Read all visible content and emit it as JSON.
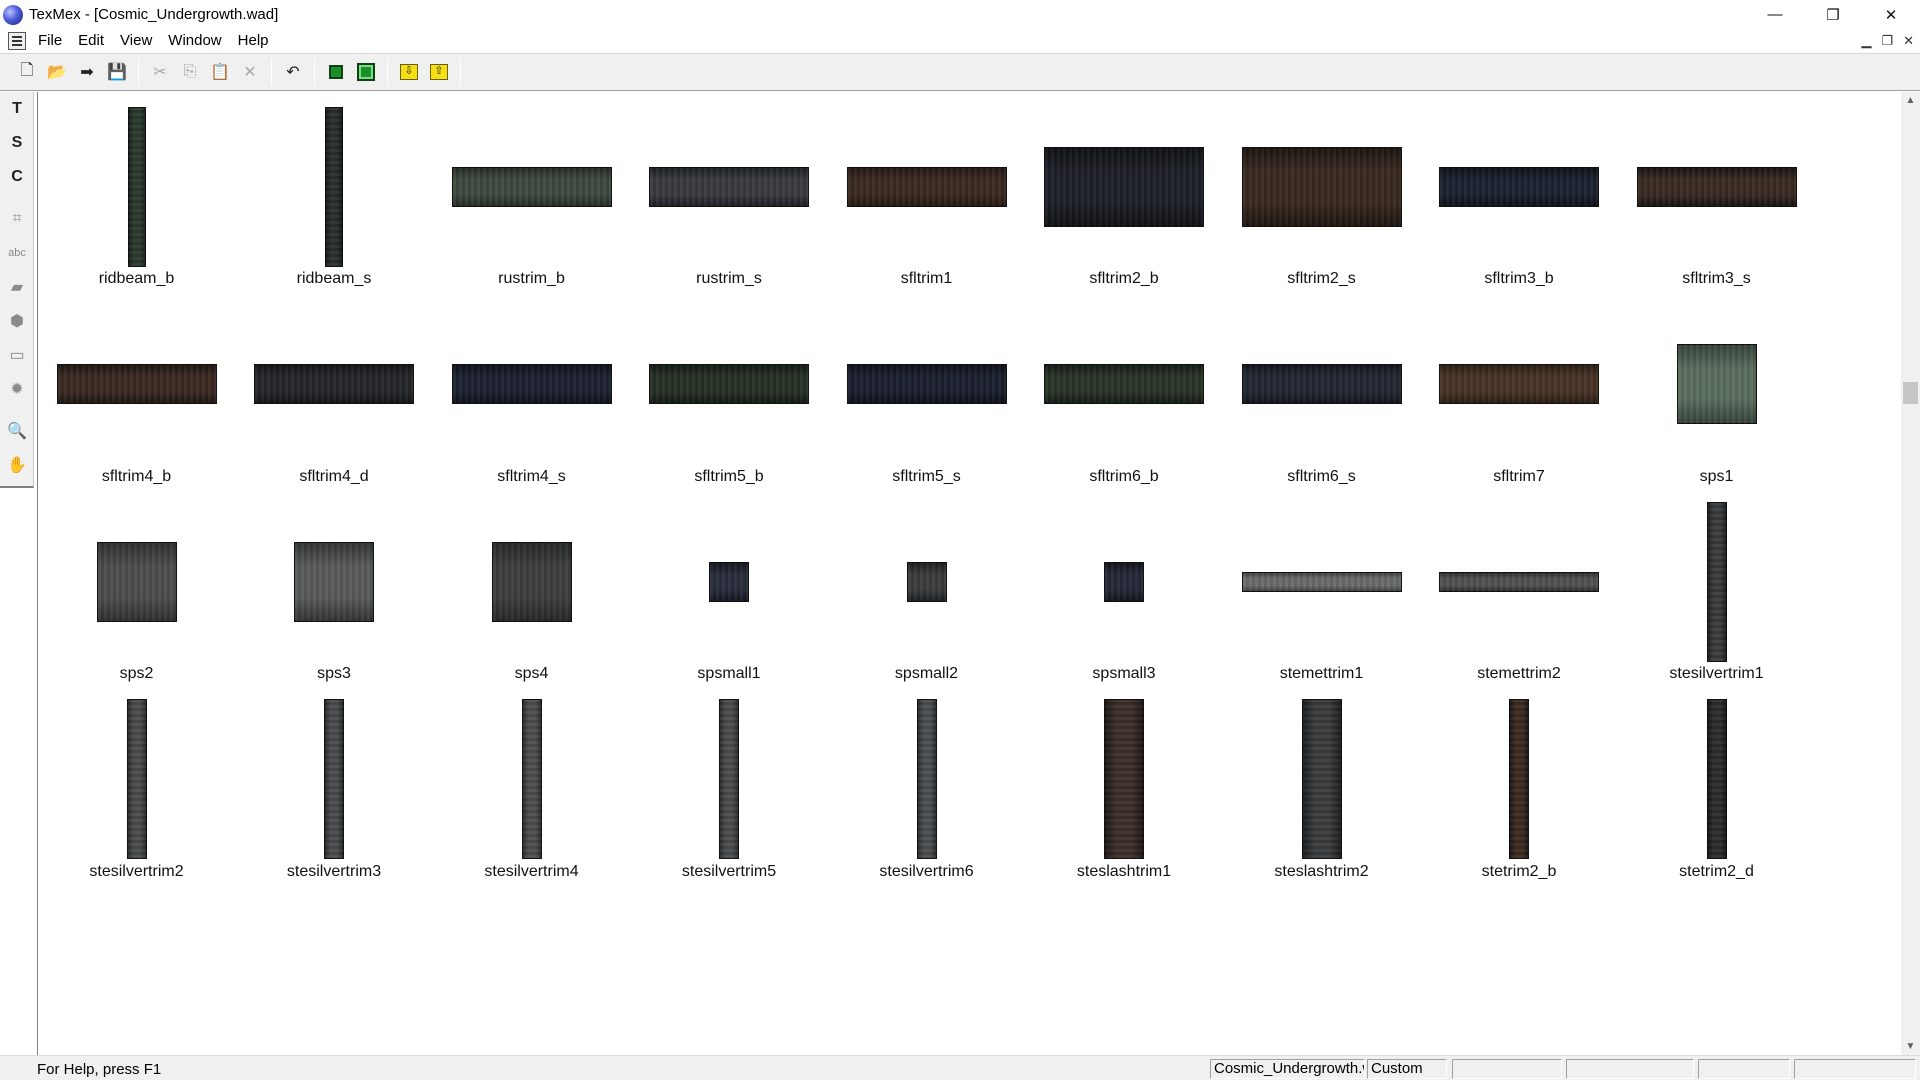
{
  "window": {
    "title": "TexMex - [Cosmic_Undergrowth.wad]"
  },
  "menu": [
    "File",
    "Edit",
    "View",
    "Window",
    "Help"
  ],
  "toolbar": {
    "buttons": [
      {
        "name": "new-file",
        "icon": "new-file-icon",
        "glyph": "🗋",
        "enabled": true
      },
      {
        "name": "open",
        "icon": "open-folder-icon",
        "glyph": "📂",
        "enabled": true
      },
      {
        "name": "forward",
        "icon": "arrow-right-icon",
        "glyph": "➡",
        "enabled": true
      },
      {
        "name": "save",
        "icon": "save-icon",
        "glyph": "💾",
        "enabled": true
      },
      {
        "name": "cut",
        "icon": "cut-icon",
        "glyph": "✂",
        "enabled": false
      },
      {
        "name": "copy",
        "icon": "copy-icon",
        "glyph": "⎘",
        "enabled": false
      },
      {
        "name": "paste",
        "icon": "paste-icon",
        "glyph": "📋",
        "enabled": false
      },
      {
        "name": "delete",
        "icon": "delete-icon",
        "glyph": "✕",
        "enabled": false
      },
      {
        "name": "undo",
        "icon": "undo-icon",
        "glyph": "↶",
        "enabled": true
      },
      {
        "name": "fit-small",
        "icon": "green-square-icon",
        "glyph": "",
        "enabled": true
      },
      {
        "name": "fit-large",
        "icon": "green-frame-icon",
        "glyph": "",
        "enabled": true
      },
      {
        "name": "import",
        "icon": "import-down-icon",
        "glyph": "⇩",
        "enabled": true
      },
      {
        "name": "export",
        "icon": "export-up-icon",
        "glyph": "⇧",
        "enabled": true
      }
    ]
  },
  "palette": [
    "T",
    "S",
    "C",
    "⌗",
    "abc",
    "▰",
    "⬢",
    "▭",
    "✹",
    "🔍",
    "✋"
  ],
  "textures": [
    [
      {
        "name": "ridbeam_b",
        "w": 18,
        "h": 160,
        "c1": "#2c3a2f",
        "c2": "#1b2220"
      },
      {
        "name": "ridbeam_s",
        "w": 18,
        "h": 160,
        "c1": "#2a302d",
        "c2": "#161a19"
      },
      {
        "name": "rustrim_b",
        "w": 160,
        "h": 40,
        "c1": "#3f4a40",
        "c2": "#262d29"
      },
      {
        "name": "rustrim_s",
        "w": 160,
        "h": 40,
        "c1": "#3a3b40",
        "c2": "#1f2025"
      },
      {
        "name": "sfltrim1",
        "w": 160,
        "h": 40,
        "c1": "#3b2a22",
        "c2": "#241913"
      },
      {
        "name": "sfltrim2_b",
        "w": 160,
        "h": 80,
        "c1": "#1d2027",
        "c2": "#101216"
      },
      {
        "name": "sfltrim2_s",
        "w": 160,
        "h": 80,
        "c1": "#3a2a21",
        "c2": "#1e1511"
      },
      {
        "name": "sfltrim3_b",
        "w": 160,
        "h": 40,
        "c1": "#1c2230",
        "c2": "#0e1118"
      },
      {
        "name": "sfltrim3_s",
        "w": 160,
        "h": 40,
        "c1": "#3a2b24",
        "c2": "#1a1512"
      }
    ],
    [
      {
        "name": "sfltrim4_b",
        "w": 160,
        "h": 40,
        "c1": "#3c2a22",
        "c2": "#1f1712"
      },
      {
        "name": "sfltrim4_d",
        "w": 160,
        "h": 40,
        "c1": "#25282b",
        "c2": "#131517"
      },
      {
        "name": "sfltrim4_s",
        "w": 160,
        "h": 40,
        "c1": "#1d2233",
        "c2": "#0f121b"
      },
      {
        "name": "sfltrim5_b",
        "w": 160,
        "h": 40,
        "c1": "#273226",
        "c2": "#141a14"
      },
      {
        "name": "sfltrim5_s",
        "w": 160,
        "h": 40,
        "c1": "#1c2130",
        "c2": "#0e1118"
      },
      {
        "name": "sfltrim6_b",
        "w": 160,
        "h": 40,
        "c1": "#2a3529",
        "c2": "#151b15"
      },
      {
        "name": "sfltrim6_s",
        "w": 160,
        "h": 40,
        "c1": "#232834",
        "c2": "#12151b"
      },
      {
        "name": "sfltrim7",
        "w": 160,
        "h": 40,
        "c1": "#4a3326",
        "c2": "#2a1d15"
      },
      {
        "name": "sps1",
        "w": 80,
        "h": 80,
        "c1": "#5b6e60",
        "c2": "#37443a"
      }
    ],
    [
      {
        "name": "sps2",
        "w": 80,
        "h": 80,
        "c1": "#4c4e50",
        "c2": "#2f3133"
      },
      {
        "name": "sps3",
        "w": 80,
        "h": 80,
        "c1": "#5a5c5c",
        "c2": "#333535"
      },
      {
        "name": "sps4",
        "w": 80,
        "h": 80,
        "c1": "#3e3f41",
        "c2": "#27282a"
      },
      {
        "name": "spsmall1",
        "w": 40,
        "h": 40,
        "c1": "#2a2e3c",
        "c2": "#141720"
      },
      {
        "name": "spsmall2",
        "w": 40,
        "h": 40,
        "c1": "#3b3d3e",
        "c2": "#1e1f20"
      },
      {
        "name": "spsmall3",
        "w": 40,
        "h": 40,
        "c1": "#262a38",
        "c2": "#12141b"
      },
      {
        "name": "stemettrim1",
        "w": 160,
        "h": 20,
        "c1": "#6a6c6d",
        "c2": "#414344"
      },
      {
        "name": "stemettrim2",
        "w": 160,
        "h": 20,
        "c1": "#505254",
        "c2": "#2c2e30"
      },
      {
        "name": "stesilvertrim1",
        "w": 20,
        "h": 160,
        "c1": "#3a3c3e",
        "c2": "#1d1f21"
      }
    ],
    [
      {
        "name": "stesilvertrim2",
        "w": 20,
        "h": 160,
        "c1": "#4a4c4d",
        "c2": "#2a2b2c"
      },
      {
        "name": "stesilvertrim3",
        "w": 20,
        "h": 160,
        "c1": "#4a4c4d",
        "c2": "#2a2b2c"
      },
      {
        "name": "stesilvertrim4",
        "w": 20,
        "h": 160,
        "c1": "#4d4f50",
        "c2": "#2c2d2e"
      },
      {
        "name": "stesilvertrim5",
        "w": 20,
        "h": 160,
        "c1": "#4b4d4e",
        "c2": "#2b2c2d"
      },
      {
        "name": "stesilvertrim6",
        "w": 20,
        "h": 160,
        "c1": "#4c4e4f",
        "c2": "#2b2c2d"
      },
      {
        "name": "steslashtrim1",
        "w": 40,
        "h": 160,
        "c1": "#3d302a",
        "c2": "#1e1815"
      },
      {
        "name": "steslashtrim2",
        "w": 40,
        "h": 160,
        "c1": "#3a3c3e",
        "c2": "#1c1d1f"
      },
      {
        "name": "stetrim2_b",
        "w": 20,
        "h": 160,
        "c1": "#3d2c22",
        "c2": "#1e1611"
      },
      {
        "name": "stetrim2_d",
        "w": 20,
        "h": 160,
        "c1": "#2b2d2f",
        "c2": "#151617"
      }
    ]
  ],
  "status": {
    "help_text": "For Help, press F1",
    "file_pane": "Cosmic_Undergrowth.wad",
    "palette_pane": "Custom"
  }
}
